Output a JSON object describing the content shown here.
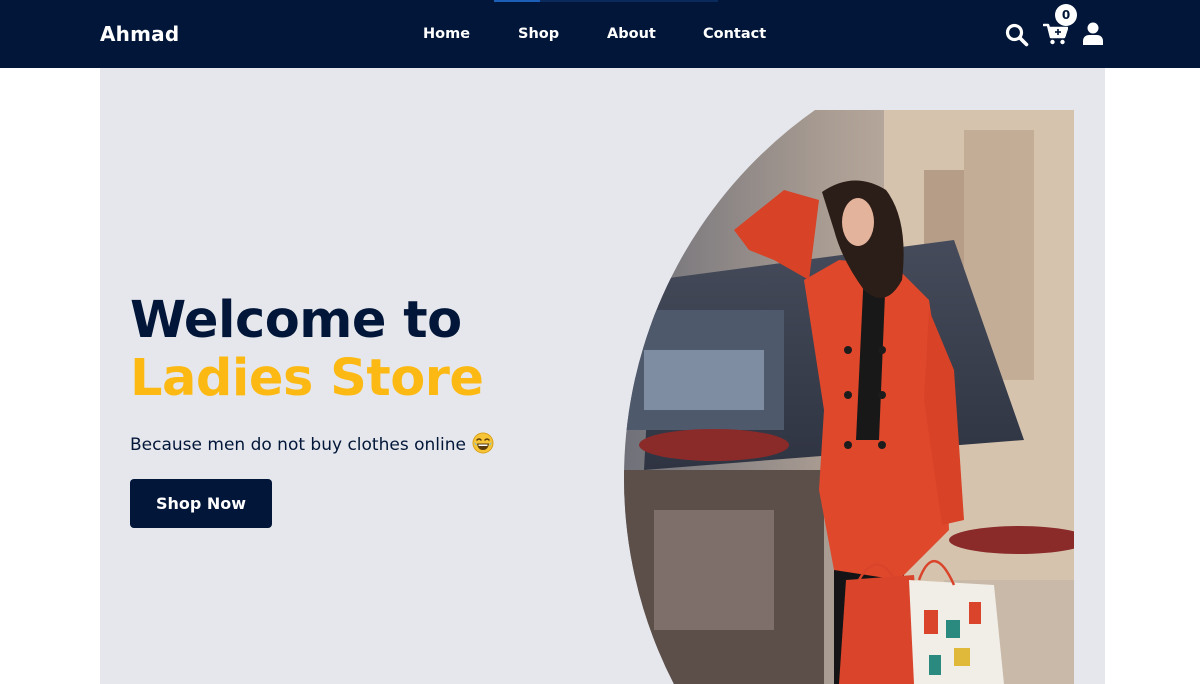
{
  "nav": {
    "brand": "Ahmad",
    "links": [
      {
        "label": "Home"
      },
      {
        "label": "Shop"
      },
      {
        "label": "About"
      },
      {
        "label": "Contact"
      }
    ],
    "icons": [
      "search-icon",
      "cart-icon",
      "user-icon"
    ],
    "cart_count": "0"
  },
  "hero": {
    "title_line1": "Welcome to",
    "title_line2": "Ladies Store",
    "subtitle": "Because men do not buy clothes online",
    "subtitle_emoji": "laughing-emoji",
    "button_label": "Shop Now",
    "image": "woman-in-red-coat-with-shopping-bags"
  },
  "colors": {
    "navy": "#011638",
    "accent_yellow": "#fdb913",
    "hero_bg": "#e6e7ec",
    "coat_red": "#e0482c"
  }
}
